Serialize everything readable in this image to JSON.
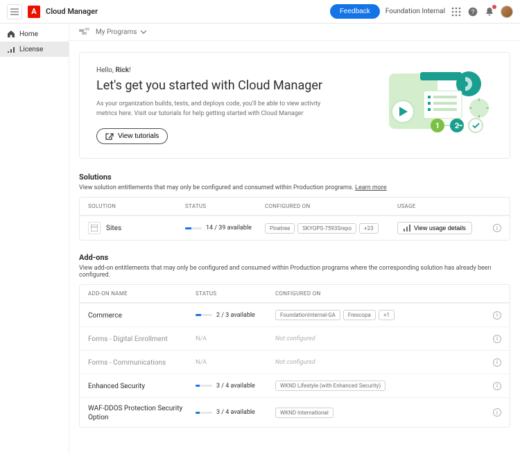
{
  "header": {
    "brand": "Cloud Manager",
    "feedback": "Feedback",
    "foundation": "Foundation Internal"
  },
  "sidebar": {
    "items": [
      {
        "label": "Home"
      },
      {
        "label": "License"
      }
    ]
  },
  "crumb": {
    "programs": "My Programs"
  },
  "hero": {
    "hello_prefix": "Hello, ",
    "hello_name": "Rick",
    "hello_suffix": "!",
    "title": "Let's get you started with Cloud Manager",
    "desc": "As your organization builds, tests, and deploys code, you'll be able to view activity metrics here. Visit our tutorials for help getting started with Cloud Manager",
    "tutorials": "View tutorials"
  },
  "solutions": {
    "title": "Solutions",
    "desc": "View solution entitlements that may only be configured and consumed within Production programs. ",
    "learn": "Learn more",
    "headers": {
      "solution": "SOLUTION",
      "status": "STATUS",
      "configured": "CONFIGURED ON",
      "usage": "USAGE"
    },
    "rows": [
      {
        "name": "Sites",
        "status_text": "14 / 39 available",
        "status_pct": 36,
        "chips": [
          "Pinetree",
          "SKYOPS-7593Srepo",
          "+23"
        ],
        "usage": "View usage details"
      }
    ]
  },
  "addons": {
    "title": "Add-ons",
    "desc": "View add-on entitlements that may only be configured and consumed within Production programs where the corresponding solution has already been configured.",
    "headers": {
      "name": "ADD-ON NAME",
      "status": "STATUS",
      "configured": "CONFIGURED ON"
    },
    "rows": [
      {
        "name": "Commerce",
        "status_text": "2 / 3 available",
        "status_pct": 33,
        "chips": [
          "FoundationInternal-GA",
          "Frescopa",
          "+1"
        ]
      },
      {
        "name": "Forms - Digital Enrollment",
        "na": "N/A",
        "notconf": "Not configured"
      },
      {
        "name": "Forms - Communications",
        "na": "N/A",
        "notconf": "Not configured"
      },
      {
        "name": "Enhanced Security",
        "status_text": "3 / 4 available",
        "status_pct": 25,
        "chips": [
          "WKND Lifestyle (with Enhanced Security)"
        ]
      },
      {
        "name": "WAF-DDOS Protection Security Option",
        "status_text": "3 / 4 available",
        "status_pct": 25,
        "chips": [
          "WKND International"
        ]
      }
    ]
  }
}
